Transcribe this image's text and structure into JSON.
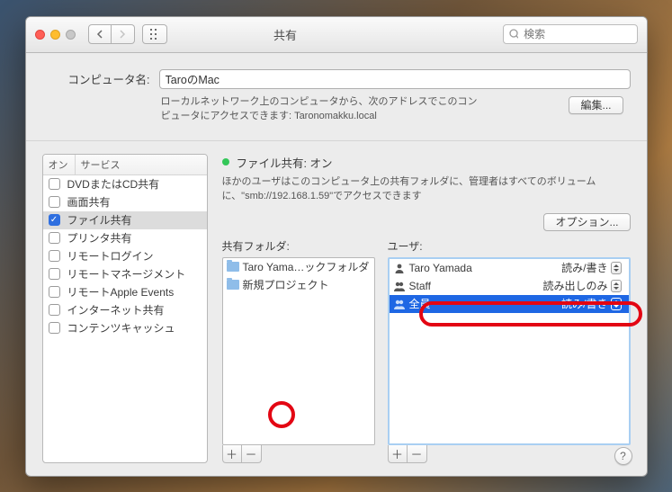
{
  "window": {
    "title": "共有"
  },
  "toolbar": {
    "search_placeholder": "検索"
  },
  "computer_name": {
    "label": "コンピュータ名:",
    "value": "TaroのMac",
    "desc1": "ローカルネットワーク上のコンピュータから、次のアドレスでこのコンピュータにアクセスできます: ",
    "desc2": "Taronomakku.local",
    "edit_label": "編集..."
  },
  "services": {
    "head_on": "オン",
    "head_service": "サービス",
    "items": [
      {
        "on": false,
        "label": "DVDまたはCD共有"
      },
      {
        "on": false,
        "label": "画面共有"
      },
      {
        "on": true,
        "label": "ファイル共有",
        "selected": true
      },
      {
        "on": false,
        "label": "プリンタ共有"
      },
      {
        "on": false,
        "label": "リモートログイン"
      },
      {
        "on": false,
        "label": "リモートマネージメント"
      },
      {
        "on": false,
        "label": "リモートApple Events"
      },
      {
        "on": false,
        "label": "インターネット共有"
      },
      {
        "on": false,
        "label": "コンテンツキャッシュ"
      }
    ]
  },
  "file_sharing": {
    "status_title": "ファイル共有: オン",
    "status_desc": "ほかのユーザはこのコンピュータ上の共有フォルダに、管理者はすべてのボリュームに、\"smb://192.168.1.59\"でアクセスできます",
    "options_label": "オプション..."
  },
  "folders": {
    "label": "共有フォルダ:",
    "items": [
      {
        "label": "Taro Yama…ックフォルダ"
      },
      {
        "label": "新規プロジェクト"
      }
    ]
  },
  "users": {
    "label": "ユーザ:",
    "items": [
      {
        "icon": "user",
        "label": "Taro Yamada",
        "perm": "読み/書き",
        "selected": false
      },
      {
        "icon": "group",
        "label": "Staff",
        "perm": "読み出しのみ",
        "selected": false
      },
      {
        "icon": "group",
        "label": "全員",
        "perm": "読み/書き",
        "selected": true
      }
    ]
  },
  "help": {
    "label": "?"
  }
}
